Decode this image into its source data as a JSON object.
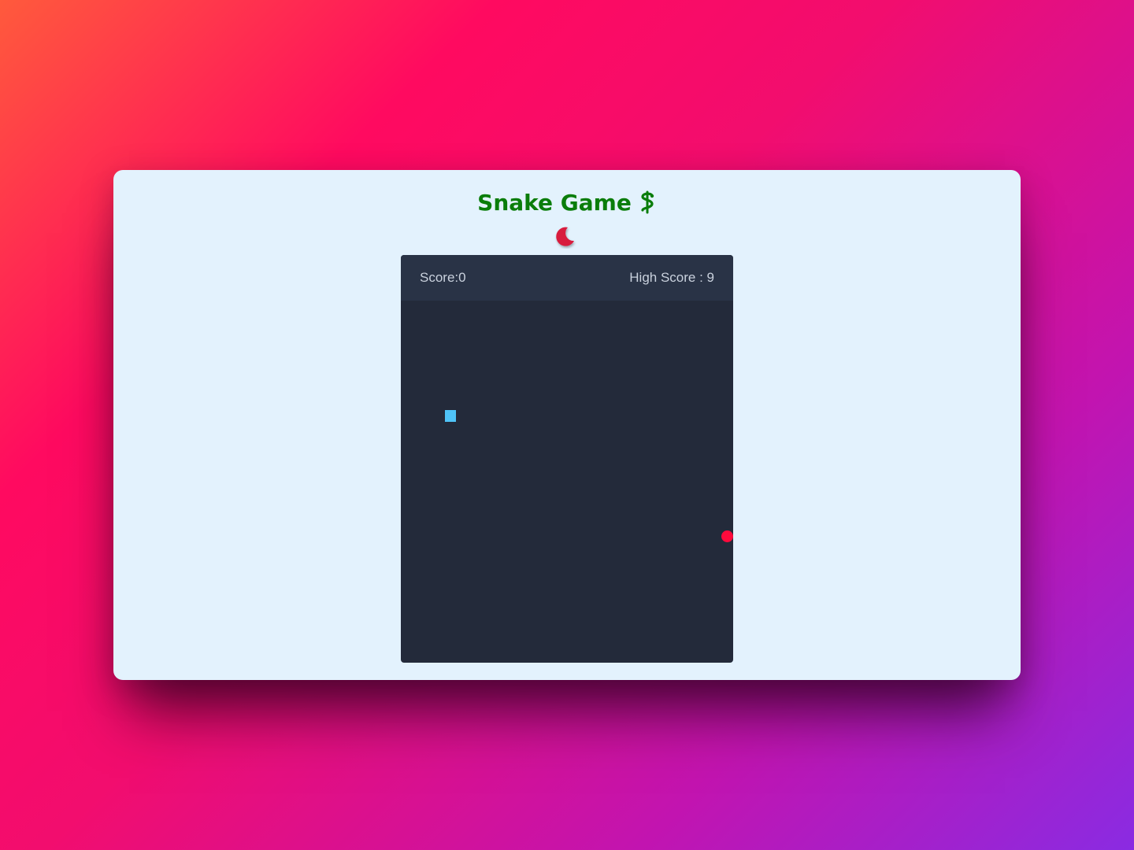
{
  "app": {
    "title": "Snake Game"
  },
  "theme_toggle": {
    "icon": "moon-icon",
    "color": "#d81b3c"
  },
  "scoreboard": {
    "score_text": "Score:0",
    "high_score_text": "High Score : 9"
  },
  "game": {
    "snake_color": "#4fc3f7",
    "food_color": "#ff0a3c",
    "board_color": "#232a3a",
    "header_color": "#293346"
  }
}
